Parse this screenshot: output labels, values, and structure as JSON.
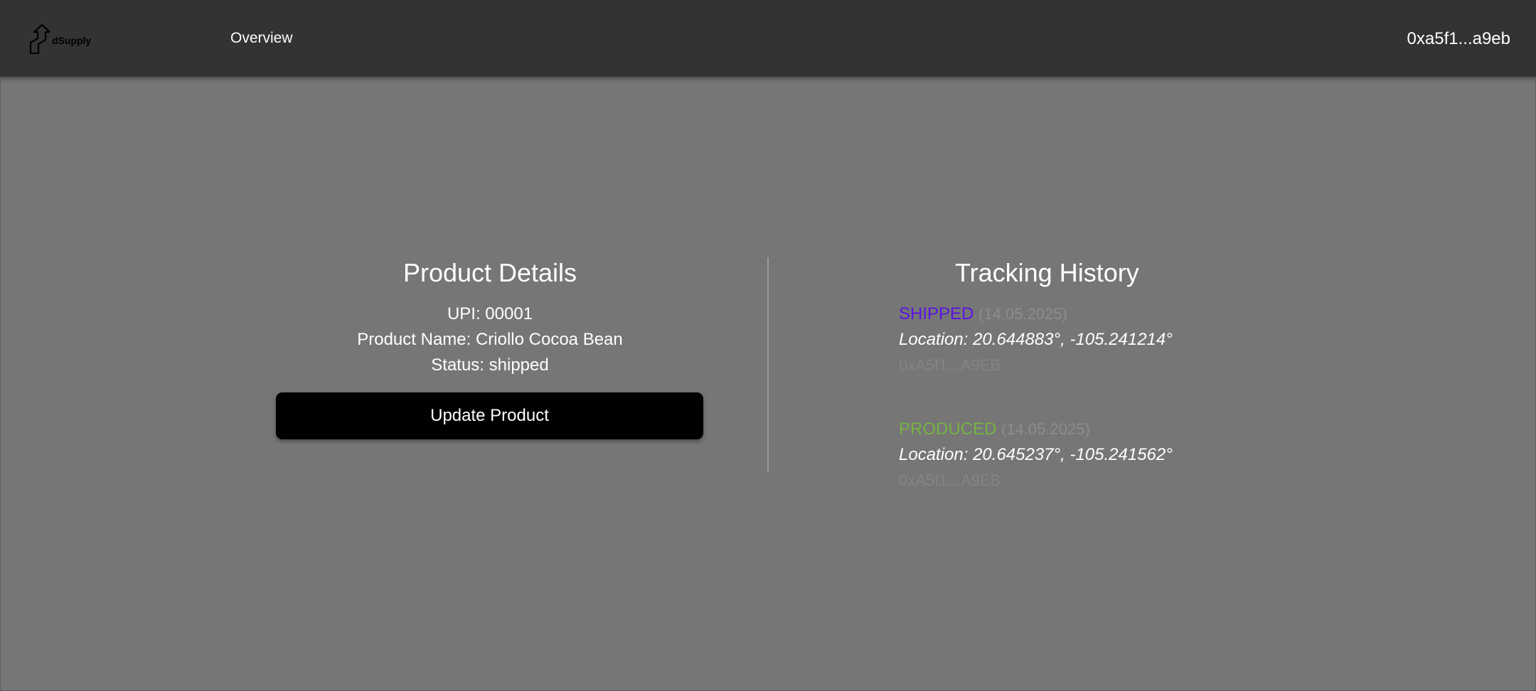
{
  "header": {
    "logo_text": "dSupply",
    "nav_overview": "Overview",
    "wallet_address": "0xa5f1...a9eb"
  },
  "product_details": {
    "title": "Product Details",
    "upi": "UPI: 00001",
    "product_name": "Product Name: Criollo Cocoa Bean",
    "status": "Status: shipped",
    "update_button": "Update Product"
  },
  "tracking_history": {
    "title": "Tracking History",
    "entries": [
      {
        "status": "SHIPPED",
        "status_color": "#5a14e0",
        "date": "(14.05.2025)",
        "location": "Location: 20.644883°, -105.241214°",
        "address": "0xA5f1...A9EB"
      },
      {
        "status": "PRODUCED",
        "status_color": "#77b243",
        "date": "(14.05.2025)",
        "location": "Location: 20.645237°, -105.241562°",
        "address": "0xA5f1...A9EB"
      }
    ]
  },
  "colors": {
    "topbar": "#333333",
    "background": "#767676",
    "button": "#000000"
  }
}
